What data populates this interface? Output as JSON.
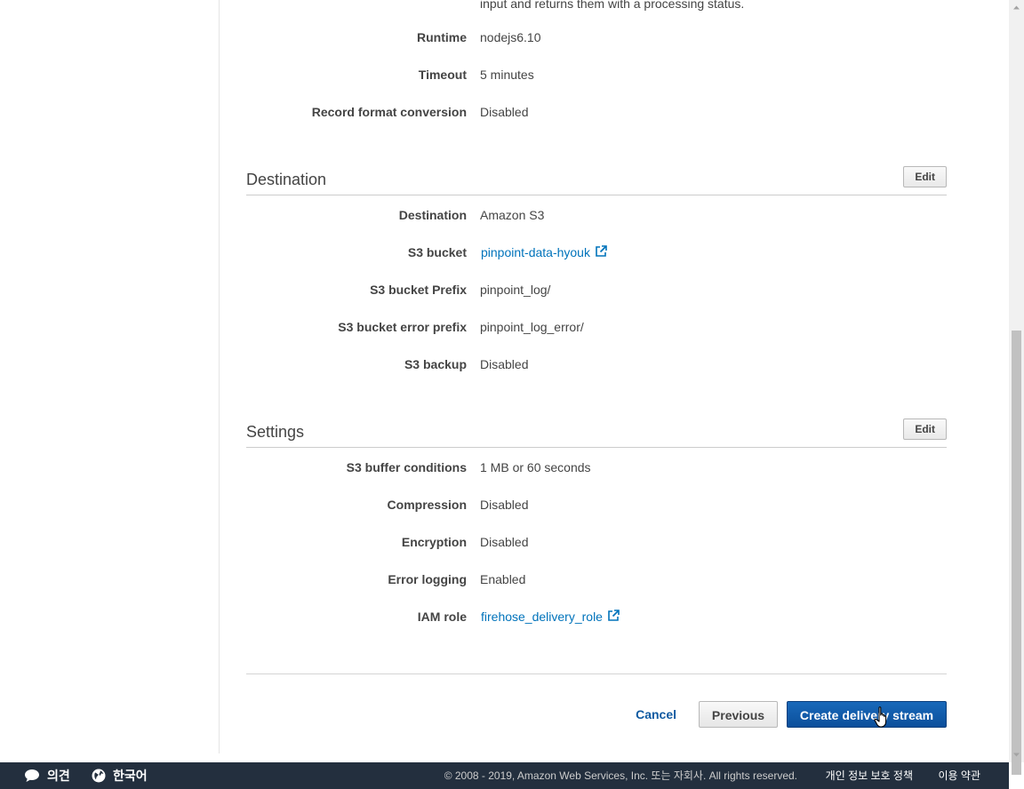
{
  "top_continuation": "input and returns them with a processing status.",
  "transform_section": {
    "rows": [
      {
        "label": "Runtime",
        "value": "nodejs6.10"
      },
      {
        "label": "Timeout",
        "value": "5 minutes"
      },
      {
        "label": "Record format conversion",
        "value": "Disabled"
      }
    ]
  },
  "destination_section": {
    "title": "Destination",
    "edit_label": "Edit",
    "rows": [
      {
        "label": "Destination",
        "value": "Amazon S3"
      },
      {
        "label": "S3 bucket",
        "value": "pinpoint-data-hyouk"
      },
      {
        "label": "S3 bucket Prefix",
        "value": "pinpoint_log/"
      },
      {
        "label": "S3 bucket error prefix",
        "value": "pinpoint_log_error/"
      },
      {
        "label": "S3 backup",
        "value": "Disabled"
      }
    ]
  },
  "settings_section": {
    "title": "Settings",
    "edit_label": "Edit",
    "rows": [
      {
        "label": "S3 buffer conditions",
        "value": "1 MB or 60 seconds"
      },
      {
        "label": "Compression",
        "value": "Disabled"
      },
      {
        "label": "Encryption",
        "value": "Disabled"
      },
      {
        "label": "Error logging",
        "value": "Enabled"
      },
      {
        "label": "IAM role",
        "value": "firehose_delivery_role"
      }
    ]
  },
  "actions": {
    "cancel": "Cancel",
    "previous": "Previous",
    "create": "Create delivery stream"
  },
  "footer": {
    "feedback": "의견",
    "language": "한국어",
    "copyright": "© 2008 - 2019, Amazon Web Services, Inc. 또는 자회사. All rights reserved.",
    "privacy": "개인 정보 보호 정책",
    "terms": "이용 약관"
  },
  "colors": {
    "link": "#0073bb",
    "primary_button": "#0b57a4",
    "footer_bg": "#232f3e"
  },
  "icons": [
    "external-link-icon",
    "speech-bubble-icon",
    "globe-icon",
    "hand-cursor-icon"
  ]
}
